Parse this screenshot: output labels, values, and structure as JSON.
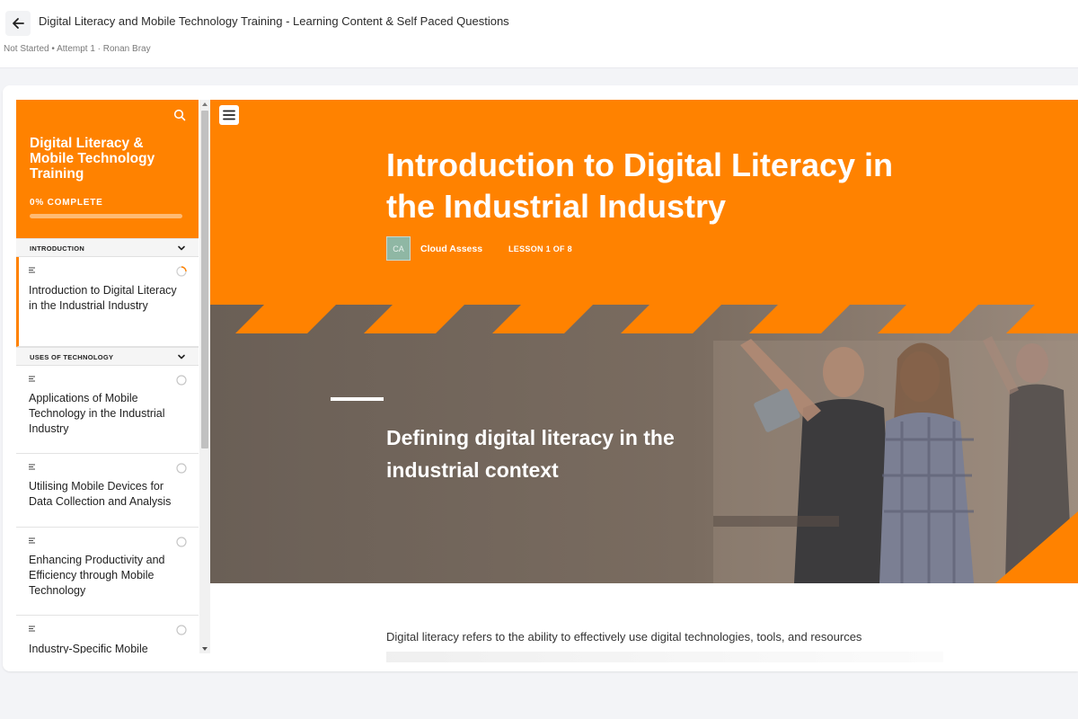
{
  "header": {
    "title": "Digital Literacy and Mobile Technology Training - Learning Content & Self Paced Questions",
    "meta": "Not Started • Attempt 1 · Ronan Bray"
  },
  "sidebar": {
    "course_title": "Digital Literacy & Mobile Technology Training",
    "progress_label": "0% COMPLETE",
    "progress": 0,
    "sections": [
      {
        "label": "INTRODUCTION",
        "lessons": [
          {
            "title": "Introduction to Digital Literacy in the Industrial Industry",
            "status": "in-progress"
          }
        ]
      },
      {
        "label": "USES OF TECHNOLOGY",
        "lessons": [
          {
            "title": "Applications of Mobile Technology in the Industrial Industry",
            "status": "not-started"
          },
          {
            "title": "Utilising Mobile Devices for Data Collection and Analysis",
            "status": "not-started"
          },
          {
            "title": "Enhancing Productivity and Efficiency through Mobile Technology",
            "status": "not-started"
          },
          {
            "title": "Industry-Specific Mobile",
            "status": "not-started"
          }
        ]
      }
    ]
  },
  "lesson": {
    "title": "Introduction to Digital Literacy in the Industrial Industry",
    "author_initials": "CA",
    "author": "Cloud Assess",
    "count_label": "LESSON 1 OF 8",
    "section_heading": "Defining digital literacy in the industrial context",
    "body_text": "Digital literacy refers to the ability to effectively use digital technologies, tools, and resources"
  },
  "colors": {
    "accent": "#ff8200",
    "photo_overlay": "#6e6258"
  },
  "icons": [
    "back-arrow-icon",
    "search-icon",
    "chevron-down-icon",
    "document-icon",
    "status-circle-icon",
    "hamburger-menu-icon"
  ]
}
